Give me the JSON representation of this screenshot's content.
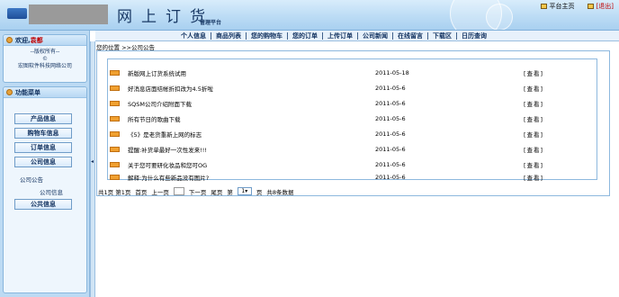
{
  "header": {
    "brand_title": "网上订货",
    "brand_subtitle": "管理平台",
    "top_links": [
      {
        "label": "平台主页",
        "color": "#000000"
      },
      {
        "label": "[退出]",
        "color": "#c00000"
      }
    ]
  },
  "nav": {
    "items": [
      "个人信息",
      "商品列表",
      "您的购物车",
      "您的订单",
      "上传订单",
      "公司新闻",
      "在线留言",
      "下载区",
      "日历查询"
    ]
  },
  "sidebar": {
    "welcome_prefix": "欢迎,",
    "welcome_user": "袁都",
    "copyright_title": "--版权所有--",
    "copyright_symbol": "©",
    "copyright_company": "宏图软件科技网络公司",
    "menu_title": "功能菜单",
    "menu_buttons": [
      "产品信息",
      "购物车信息",
      "订单信息",
      "公司信息",
      "公共信息"
    ],
    "sub_items": [
      "公司公告",
      "公司信息"
    ]
  },
  "breadcrumb": "您的位置 >>公司公告",
  "announcements": [
    {
      "title": "新版网上订货系统试用",
      "date": "2011-05-18",
      "action": "[查看]"
    },
    {
      "title": "好消息店面结帐折扣改为4.5折啦",
      "date": "2011-05-6",
      "action": "[查看]"
    },
    {
      "title": "SQSM公司介绍附面下载",
      "date": "2011-05-6",
      "action": "[查看]"
    },
    {
      "title": "所有节日的歌曲下载",
      "date": "2011-05-6",
      "action": "[查看]"
    },
    {
      "title": "《5》是老货重新上网的标志",
      "date": "2011-05-6",
      "action": "[查看]"
    },
    {
      "title": "提醒:补货单最好一次性发来!!!",
      "date": "2011-05-6",
      "action": "[查看]"
    },
    {
      "title": "关于您可要研化妆品和您可OG",
      "date": "2011-05-6",
      "action": "[查看]"
    },
    {
      "title": "解释:为什么有些新品没有图片?",
      "date": "2011-05-6",
      "action": "[查看]"
    }
  ],
  "pager": {
    "summary": "共1页 第1页",
    "first": "首页",
    "prev": "上一页",
    "next": "下一页",
    "last": "尾页",
    "goto_prefix": "第",
    "goto_value": "1",
    "goto_suffix": "页",
    "total": "共8条数据"
  },
  "colors": {
    "header_bg": "#bcdcf5",
    "sidebar_bg": "#bcdaf3",
    "badge": "#f0a030",
    "exit_link": "#c00000"
  }
}
